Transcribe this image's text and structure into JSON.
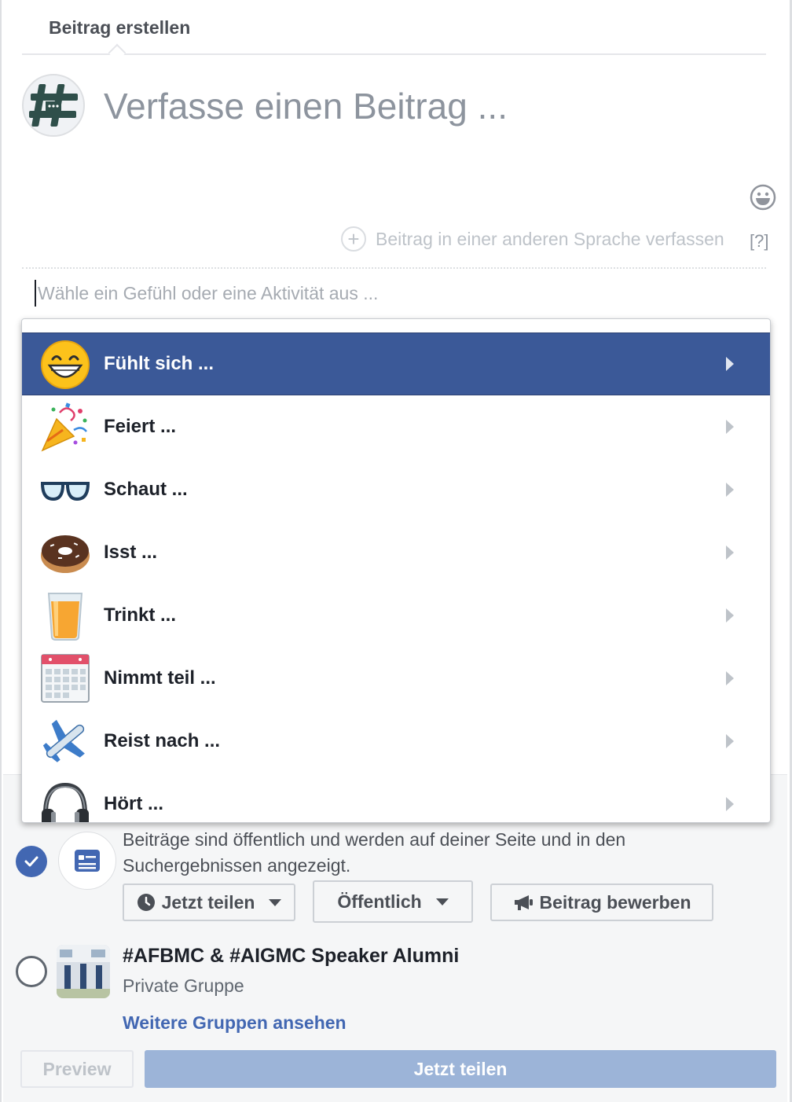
{
  "tab": {
    "title": "Beitrag erstellen"
  },
  "composer": {
    "placeholder": "Verfasse einen Beitrag ...",
    "language_link": "Beitrag in einer anderen Sprache verfassen",
    "help": "[?]",
    "activity_placeholder": "Wähle ein Gefühl oder eine Aktivität aus ..."
  },
  "dropdown": {
    "items": [
      {
        "label": "Fühlt sich ...",
        "icon": "grinning-face-icon"
      },
      {
        "label": "Feiert ...",
        "icon": "party-popper-icon"
      },
      {
        "label": "Schaut ...",
        "icon": "glasses-icon"
      },
      {
        "label": "Isst ...",
        "icon": "donut-icon"
      },
      {
        "label": "Trinkt ...",
        "icon": "juice-glass-icon"
      },
      {
        "label": "Nimmt teil ...",
        "icon": "calendar-icon"
      },
      {
        "label": "Reist nach ...",
        "icon": "airplane-icon"
      },
      {
        "label": "Hört ...",
        "icon": "headphones-icon"
      }
    ]
  },
  "audience": {
    "page_description": "Beiträge sind öffentlich und werden auf deiner Seite und in den Suchergebnissen angezeigt.",
    "share_now_label": "Jetzt teilen",
    "public_label": "Öffentlich",
    "promote_label": "Beitrag bewerben",
    "group_name": "#AFBMC & #AIGMC Speaker Alumni",
    "group_type": "Private Gruppe",
    "more_groups": "Weitere Gruppen ansehen"
  },
  "footer": {
    "preview_label": "Preview",
    "publish_label": "Jetzt teilen"
  },
  "colors": {
    "accent": "#3b5998",
    "link": "#4267b2",
    "publish_disabled": "#9cb4d8"
  }
}
